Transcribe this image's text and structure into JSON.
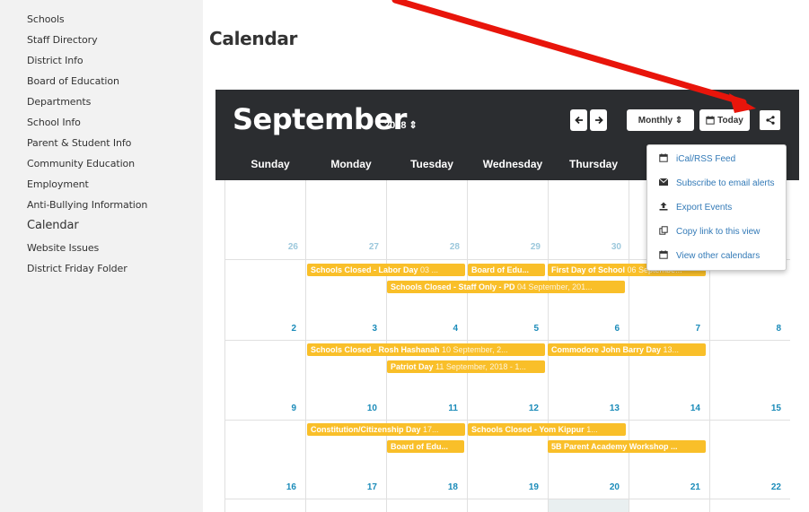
{
  "sidebar": {
    "items": [
      {
        "label": "Schools"
      },
      {
        "label": "Staff Directory"
      },
      {
        "label": "District Info"
      },
      {
        "label": "Board of Education"
      },
      {
        "label": "Departments"
      },
      {
        "label": "School Info"
      },
      {
        "label": "Parent & Student Info"
      },
      {
        "label": "Community Education"
      },
      {
        "label": "Employment"
      },
      {
        "label": "Anti-Bullying Information"
      },
      {
        "label": "Calendar",
        "active": true
      },
      {
        "label": "Website Issues"
      },
      {
        "label": "District Friday Folder"
      }
    ]
  },
  "page": {
    "title": "Calendar"
  },
  "calendar": {
    "month": "September",
    "year": "2018",
    "toolbar": {
      "prev_icon": "arrow-left-icon",
      "next_icon": "arrow-right-icon",
      "view_label": "Monthly",
      "today_label": "Today",
      "share_icon": "share-icon"
    },
    "weekdays": [
      "Sunday",
      "Monday",
      "Tuesday",
      "Wednesday",
      "Thursday"
    ],
    "weeks": [
      {
        "days": [
          "26",
          "27",
          "28",
          "29",
          "30",
          "",
          ""
        ]
      },
      {
        "days": [
          "2",
          "3",
          "4",
          "5",
          "6",
          "7",
          "8"
        ]
      },
      {
        "days": [
          "9",
          "10",
          "11",
          "12",
          "13",
          "14",
          "15"
        ]
      },
      {
        "days": [
          "16",
          "17",
          "18",
          "19",
          "20",
          "21",
          "22"
        ]
      }
    ],
    "events": [
      {
        "title": "Schools Closed - Labor Day",
        "date": "03 ..."
      },
      {
        "title": "Board of Edu...",
        "date": ""
      },
      {
        "title": "First Day of School",
        "date": "06 Septembe..."
      },
      {
        "title": "Schools Closed - Staff Only - PD",
        "date": "04 September, 201..."
      },
      {
        "title": "Schools Closed - Rosh Hashanah",
        "date": "10 September, 2..."
      },
      {
        "title": "Commodore John Barry Day",
        "date": "13..."
      },
      {
        "title": "Patriot Day",
        "date": "11 September, 2018 - 1..."
      },
      {
        "title": "Constitution/Citizenship Day",
        "date": "17..."
      },
      {
        "title": "Schools Closed - Yom Kippur",
        "date": "1..."
      },
      {
        "title": "Board of Edu...",
        "date": ""
      },
      {
        "title": "5B Parent Academy Workshop ...",
        "date": ""
      }
    ],
    "share_menu": [
      {
        "icon": "calendar-icon",
        "label": "iCal/RSS Feed"
      },
      {
        "icon": "envelope-icon",
        "label": "Subscribe to email alerts"
      },
      {
        "icon": "upload-icon",
        "label": "Export Events"
      },
      {
        "icon": "copy-link-icon",
        "label": "Copy link to this view"
      },
      {
        "icon": "calendar-icon",
        "label": "View other calendars"
      }
    ]
  },
  "colors": {
    "header_bg": "#2b2d30",
    "event_bg": "#f9bf29",
    "day_number": "#1a8bb9",
    "annotation_arrow": "#e8150b",
    "link": "#337ab7"
  }
}
